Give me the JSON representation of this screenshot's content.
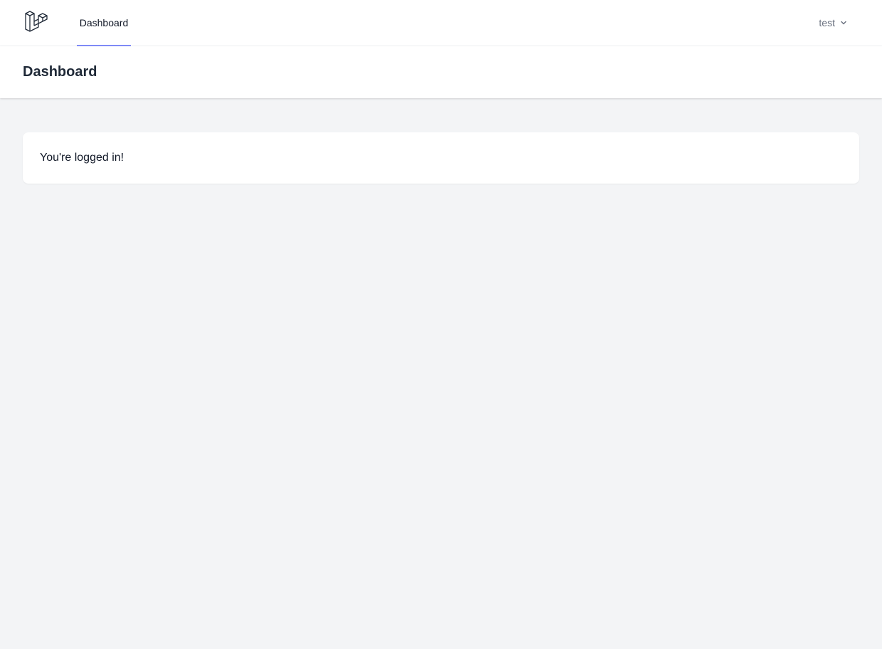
{
  "nav": {
    "logo_icon": "laravel-logo-icon",
    "links": [
      {
        "label": "Dashboard",
        "active": true
      }
    ],
    "user": {
      "name": "test",
      "icon": "chevron-down-icon"
    },
    "active_color": "#818cf8"
  },
  "header": {
    "title": "Dashboard"
  },
  "main": {
    "message": "You're logged in!"
  }
}
